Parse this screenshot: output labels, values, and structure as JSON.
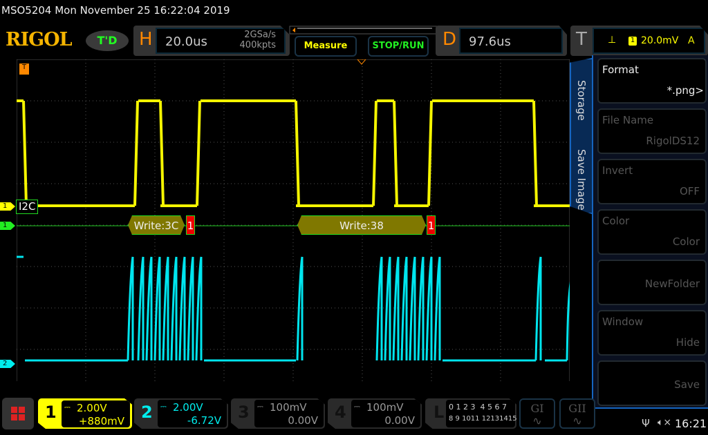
{
  "title": "MSO5204  Mon November 25 16:22:04 2019",
  "logo": "RIGOL",
  "trigger_status": "T'D",
  "horizontal": {
    "letter": "H",
    "timebase": "20.0us",
    "sample_rate": "2GSa/s",
    "memory": "400kpts"
  },
  "buttons": {
    "measure": "Measure",
    "stop_run": "STOP/RUN"
  },
  "delay": {
    "letter": "D",
    "value": "97.6us"
  },
  "trigger": {
    "letter": "T",
    "source": "1",
    "level": "20.0mV",
    "mode": "A"
  },
  "side_tabs": [
    "Storage",
    "Save Image"
  ],
  "menu": [
    {
      "label": "Format",
      "value": "*.png>"
    },
    {
      "label": "File Name",
      "value": "RigolDS12"
    },
    {
      "label": "Invert",
      "value": "OFF"
    },
    {
      "label": "Color",
      "value": "Color"
    },
    {
      "label": "",
      "value": "NewFolder"
    },
    {
      "label": "Window",
      "value": "Hide"
    },
    {
      "label": "",
      "value": "Save"
    }
  ],
  "markers": {
    "ch1": "1",
    "bus": "1",
    "ch2": "2",
    "bus_label": "I2C"
  },
  "decode": [
    {
      "text": "Write:3C",
      "ack": "1"
    },
    {
      "text": "Write:38",
      "ack": "1"
    }
  ],
  "channels": [
    {
      "num": "1",
      "scale": "2.00V",
      "offset": "+880mV",
      "color": "#f5f500"
    },
    {
      "num": "2",
      "scale": "2.00V",
      "offset": "-6.72V",
      "color": "#00e5ee"
    },
    {
      "num": "3",
      "scale": "100mV",
      "offset": "0.00V",
      "color": "#888888"
    },
    {
      "num": "4",
      "scale": "100mV",
      "offset": "0.00V",
      "color": "#888888"
    }
  ],
  "logic": {
    "letter": "L",
    "row1": "0 1 2 3  4 5 6 7",
    "row2": "8 9 1011 12131415"
  },
  "generators": [
    "GI",
    "GII"
  ],
  "status": {
    "time": "16:21"
  }
}
